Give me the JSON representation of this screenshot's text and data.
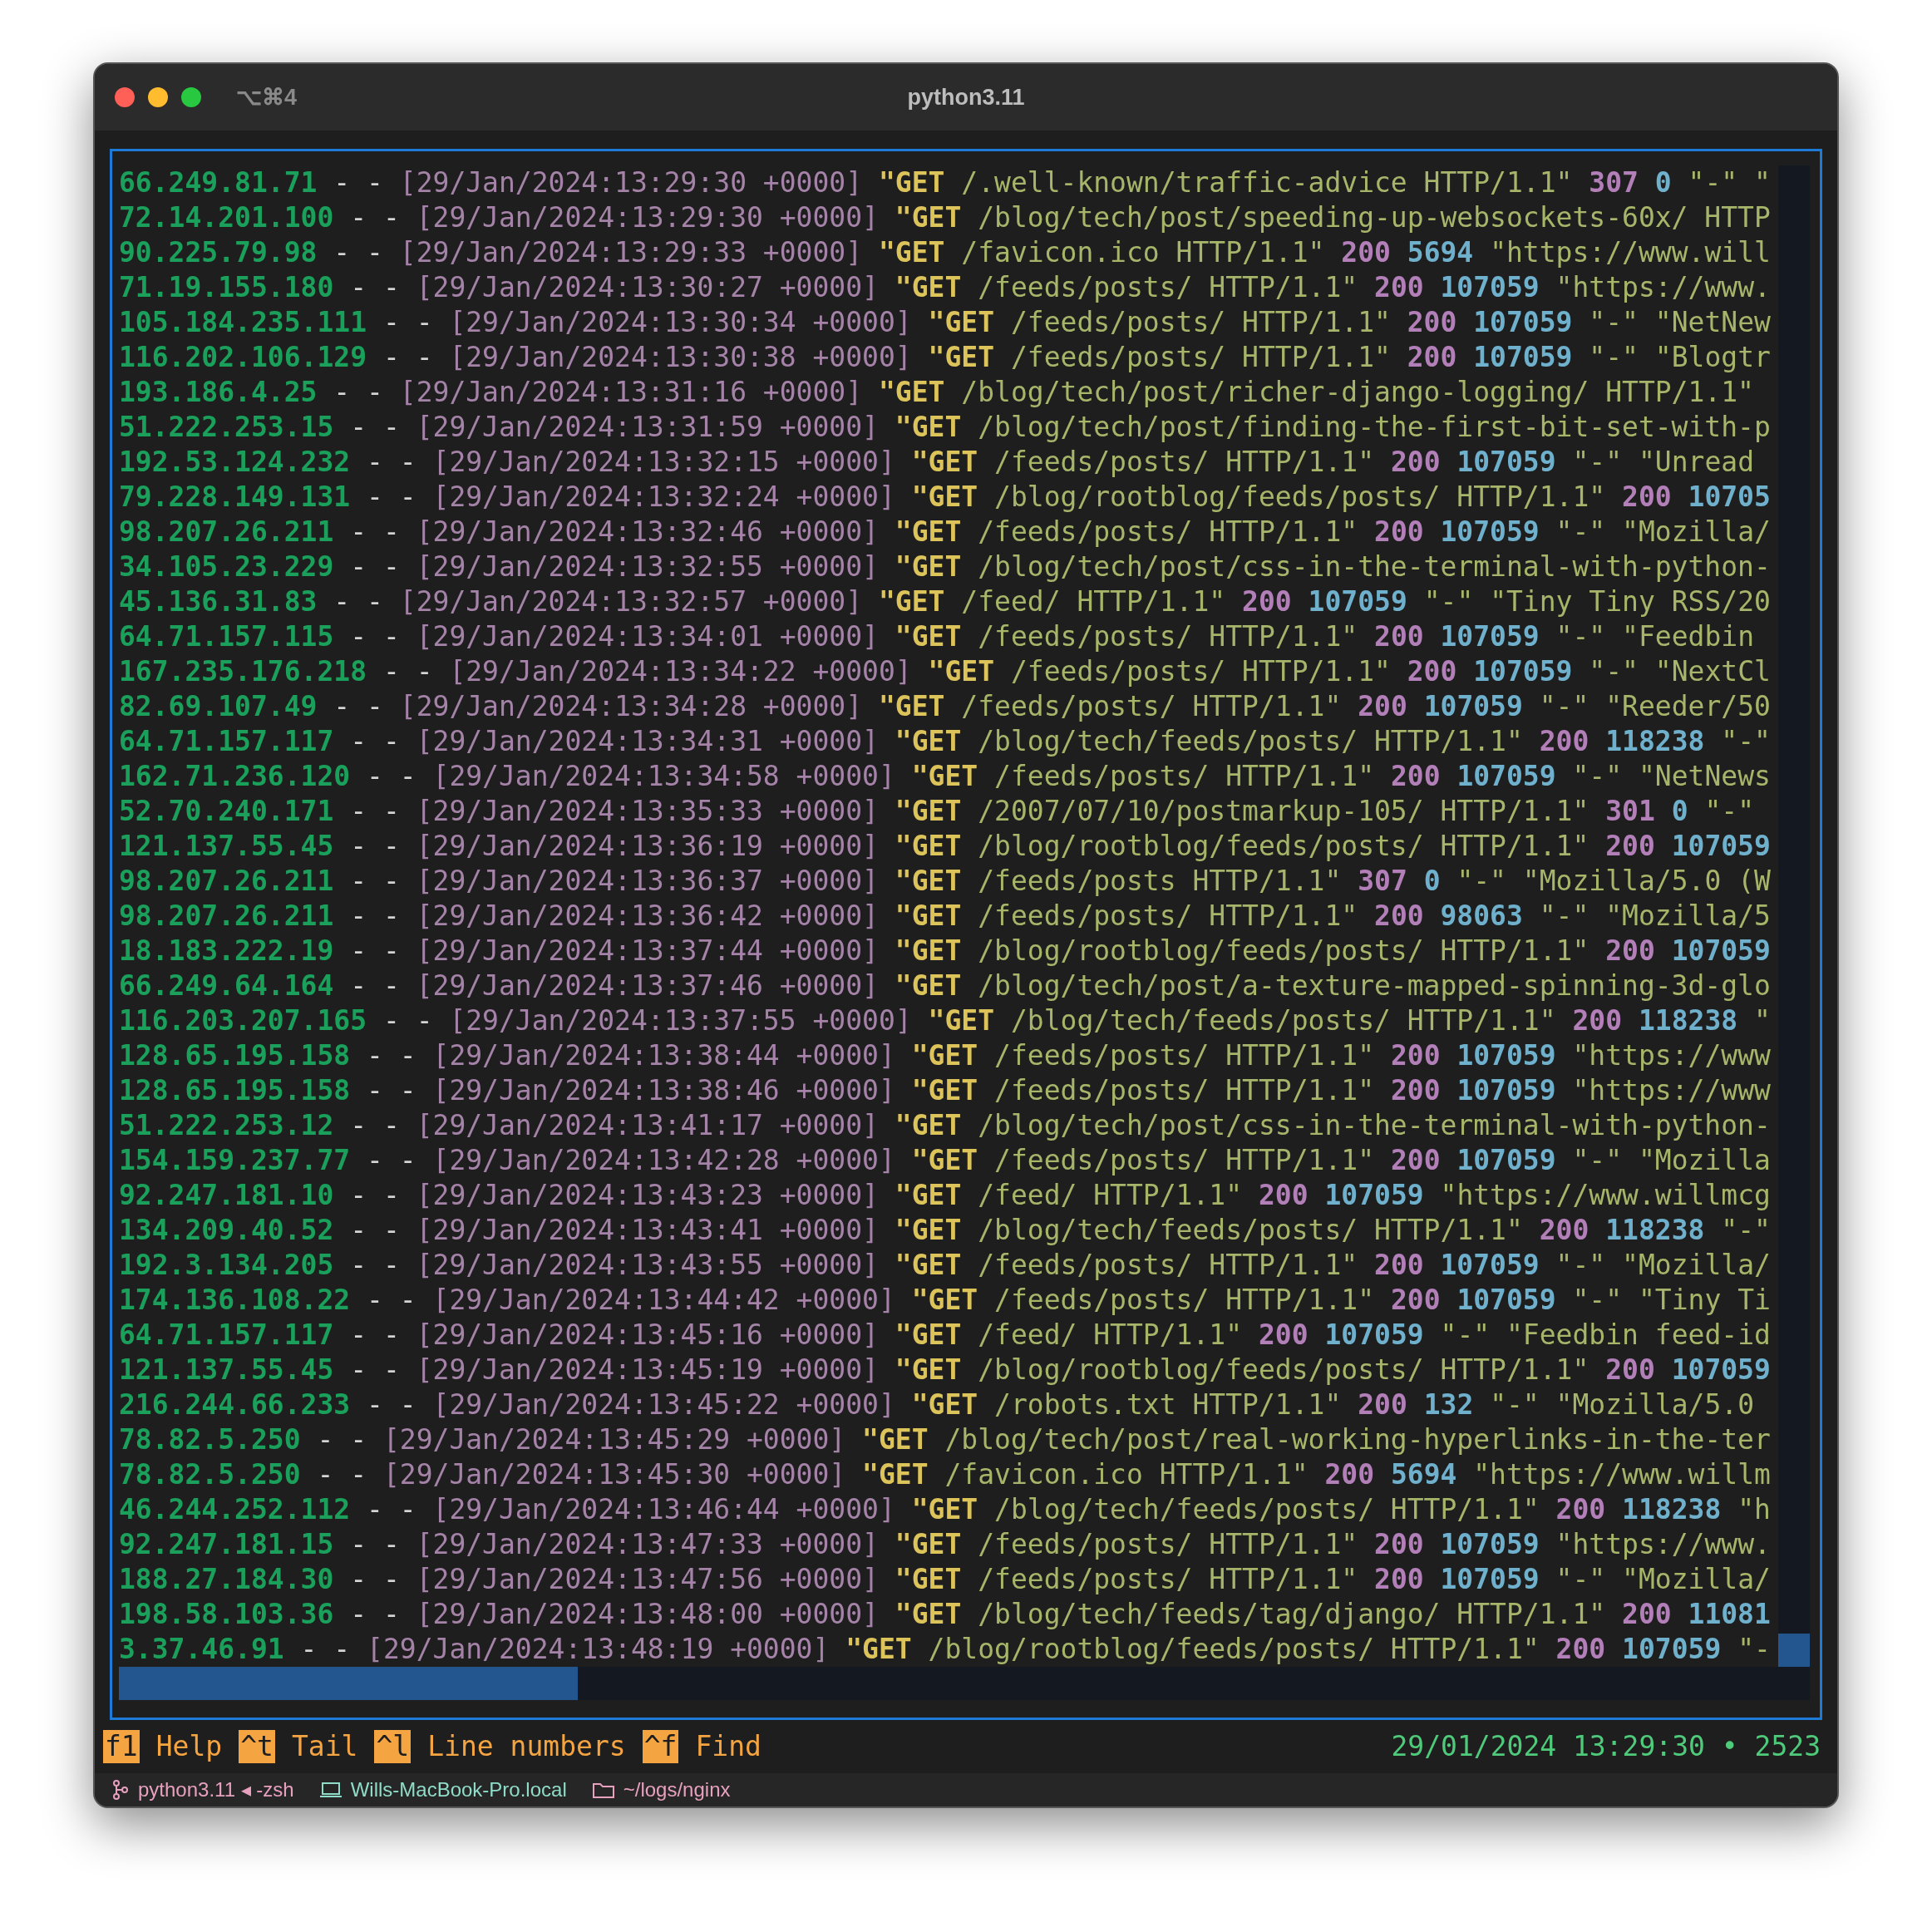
{
  "window": {
    "shortcut": "⌥⌘4",
    "title": "python3.11"
  },
  "log_lines": [
    {
      "ip": "66.249.81.71",
      "ident": "- -",
      "time": "[29/Jan/2024:13:29:30 +0000]",
      "method": "\"GET",
      "request": "/.well-known/traffic-advice HTTP/1.1\"",
      "status": "307",
      "size": "0",
      "tail": "\"-\" \""
    },
    {
      "ip": "72.14.201.100",
      "ident": "- -",
      "time": "[29/Jan/2024:13:29:30 +0000]",
      "method": "\"GET",
      "request": "/blog/tech/post/speeding-up-websockets-60x/ HTTP"
    },
    {
      "ip": "90.225.79.98",
      "ident": "- -",
      "time": "[29/Jan/2024:13:29:33 +0000]",
      "method": "\"GET",
      "request": "/favicon.ico HTTP/1.1\"",
      "status": "200",
      "size": "5694",
      "tail": "\"https://www.will"
    },
    {
      "ip": "71.19.155.180",
      "ident": "- -",
      "time": "[29/Jan/2024:13:30:27 +0000]",
      "method": "\"GET",
      "request": "/feeds/posts/ HTTP/1.1\"",
      "status": "200",
      "size": "107059",
      "tail": "\"https://www."
    },
    {
      "ip": "105.184.235.111",
      "ident": "- -",
      "time": "[29/Jan/2024:13:30:34 +0000]",
      "method": "\"GET",
      "request": "/feeds/posts/ HTTP/1.1\"",
      "status": "200",
      "size": "107059",
      "tail": "\"-\" \"NetNew"
    },
    {
      "ip": "116.202.106.129",
      "ident": "- -",
      "time": "[29/Jan/2024:13:30:38 +0000]",
      "method": "\"GET",
      "request": "/feeds/posts/ HTTP/1.1\"",
      "status": "200",
      "size": "107059",
      "tail": "\"-\" \"Blogtr"
    },
    {
      "ip": "193.186.4.25",
      "ident": "- -",
      "time": "[29/Jan/2024:13:31:16 +0000]",
      "method": "\"GET",
      "request": "/blog/tech/post/richer-django-logging/ HTTP/1.1\""
    },
    {
      "ip": "51.222.253.15",
      "ident": "- -",
      "time": "[29/Jan/2024:13:31:59 +0000]",
      "method": "\"GET",
      "request": "/blog/tech/post/finding-the-first-bit-set-with-p"
    },
    {
      "ip": "192.53.124.232",
      "ident": "- -",
      "time": "[29/Jan/2024:13:32:15 +0000]",
      "method": "\"GET",
      "request": "/feeds/posts/ HTTP/1.1\"",
      "status": "200",
      "size": "107059",
      "tail": "\"-\" \"Unread"
    },
    {
      "ip": "79.228.149.131",
      "ident": "- -",
      "time": "[29/Jan/2024:13:32:24 +0000]",
      "method": "\"GET",
      "request": "/blog/rootblog/feeds/posts/ HTTP/1.1\"",
      "status": "200",
      "size": "10705"
    },
    {
      "ip": "98.207.26.211",
      "ident": "- -",
      "time": "[29/Jan/2024:13:32:46 +0000]",
      "method": "\"GET",
      "request": "/feeds/posts/ HTTP/1.1\"",
      "status": "200",
      "size": "107059",
      "tail": "\"-\" \"Mozilla/"
    },
    {
      "ip": "34.105.23.229",
      "ident": "- -",
      "time": "[29/Jan/2024:13:32:55 +0000]",
      "method": "\"GET",
      "request": "/blog/tech/post/css-in-the-terminal-with-python-"
    },
    {
      "ip": "45.136.31.83",
      "ident": "- -",
      "time": "[29/Jan/2024:13:32:57 +0000]",
      "method": "\"GET",
      "request": "/feed/ HTTP/1.1\"",
      "status": "200",
      "size": "107059",
      "tail": "\"-\" \"Tiny Tiny RSS/20"
    },
    {
      "ip": "64.71.157.115",
      "ident": "- -",
      "time": "[29/Jan/2024:13:34:01 +0000]",
      "method": "\"GET",
      "request": "/feeds/posts/ HTTP/1.1\"",
      "status": "200",
      "size": "107059",
      "tail": "\"-\" \"Feedbin"
    },
    {
      "ip": "167.235.176.218",
      "ident": "- -",
      "time": "[29/Jan/2024:13:34:22 +0000]",
      "method": "\"GET",
      "request": "/feeds/posts/ HTTP/1.1\"",
      "status": "200",
      "size": "107059",
      "tail": "\"-\" \"NextCl"
    },
    {
      "ip": "82.69.107.49",
      "ident": "- -",
      "time": "[29/Jan/2024:13:34:28 +0000]",
      "method": "\"GET",
      "request": "/feeds/posts/ HTTP/1.1\"",
      "status": "200",
      "size": "107059",
      "tail": "\"-\" \"Reeder/50"
    },
    {
      "ip": "64.71.157.117",
      "ident": "- -",
      "time": "[29/Jan/2024:13:34:31 +0000]",
      "method": "\"GET",
      "request": "/blog/tech/feeds/posts/ HTTP/1.1\"",
      "status": "200",
      "size": "118238",
      "tail": "\"-\""
    },
    {
      "ip": "162.71.236.120",
      "ident": "- -",
      "time": "[29/Jan/2024:13:34:58 +0000]",
      "method": "\"GET",
      "request": "/feeds/posts/ HTTP/1.1\"",
      "status": "200",
      "size": "107059",
      "tail": "\"-\" \"NetNews"
    },
    {
      "ip": "52.70.240.171",
      "ident": "- -",
      "time": "[29/Jan/2024:13:35:33 +0000]",
      "method": "\"GET",
      "request": "/2007/07/10/postmarkup-105/ HTTP/1.1\"",
      "status": "301",
      "size": "0",
      "tail": "\"-\""
    },
    {
      "ip": "121.137.55.45",
      "ident": "- -",
      "time": "[29/Jan/2024:13:36:19 +0000]",
      "method": "\"GET",
      "request": "/blog/rootblog/feeds/posts/ HTTP/1.1\"",
      "status": "200",
      "size": "107059"
    },
    {
      "ip": "98.207.26.211",
      "ident": "- -",
      "time": "[29/Jan/2024:13:36:37 +0000]",
      "method": "\"GET",
      "request": "/feeds/posts HTTP/1.1\"",
      "status": "307",
      "size": "0",
      "tail": "\"-\" \"Mozilla/5.0 (W"
    },
    {
      "ip": "98.207.26.211",
      "ident": "- -",
      "time": "[29/Jan/2024:13:36:42 +0000]",
      "method": "\"GET",
      "request": "/feeds/posts/ HTTP/1.1\"",
      "status": "200",
      "size": "98063",
      "tail": "\"-\" \"Mozilla/5"
    },
    {
      "ip": "18.183.222.19",
      "ident": "- -",
      "time": "[29/Jan/2024:13:37:44 +0000]",
      "method": "\"GET",
      "request": "/blog/rootblog/feeds/posts/ HTTP/1.1\"",
      "status": "200",
      "size": "107059"
    },
    {
      "ip": "66.249.64.164",
      "ident": "- -",
      "time": "[29/Jan/2024:13:37:46 +0000]",
      "method": "\"GET",
      "request": "/blog/tech/post/a-texture-mapped-spinning-3d-glo"
    },
    {
      "ip": "116.203.207.165",
      "ident": "- -",
      "time": "[29/Jan/2024:13:37:55 +0000]",
      "method": "\"GET",
      "request": "/blog/tech/feeds/posts/ HTTP/1.1\"",
      "status": "200",
      "size": "118238",
      "tail": "\""
    },
    {
      "ip": "128.65.195.158",
      "ident": "- -",
      "time": "[29/Jan/2024:13:38:44 +0000]",
      "method": "\"GET",
      "request": "/feeds/posts/ HTTP/1.1\"",
      "status": "200",
      "size": "107059",
      "tail": "\"https://www"
    },
    {
      "ip": "128.65.195.158",
      "ident": "- -",
      "time": "[29/Jan/2024:13:38:46 +0000]",
      "method": "\"GET",
      "request": "/feeds/posts/ HTTP/1.1\"",
      "status": "200",
      "size": "107059",
      "tail": "\"https://www"
    },
    {
      "ip": "51.222.253.12",
      "ident": "- -",
      "time": "[29/Jan/2024:13:41:17 +0000]",
      "method": "\"GET",
      "request": "/blog/tech/post/css-in-the-terminal-with-python-"
    },
    {
      "ip": "154.159.237.77",
      "ident": "- -",
      "time": "[29/Jan/2024:13:42:28 +0000]",
      "method": "\"GET",
      "request": "/feeds/posts/ HTTP/1.1\"",
      "status": "200",
      "size": "107059",
      "tail": "\"-\" \"Mozilla"
    },
    {
      "ip": "92.247.181.10",
      "ident": "- -",
      "time": "[29/Jan/2024:13:43:23 +0000]",
      "method": "\"GET",
      "request": "/feed/ HTTP/1.1\"",
      "status": "200",
      "size": "107059",
      "tail": "\"https://www.willmcg"
    },
    {
      "ip": "134.209.40.52",
      "ident": "- -",
      "time": "[29/Jan/2024:13:43:41 +0000]",
      "method": "\"GET",
      "request": "/blog/tech/feeds/posts/ HTTP/1.1\"",
      "status": "200",
      "size": "118238",
      "tail": "\"-\""
    },
    {
      "ip": "192.3.134.205",
      "ident": "- -",
      "time": "[29/Jan/2024:13:43:55 +0000]",
      "method": "\"GET",
      "request": "/feeds/posts/ HTTP/1.1\"",
      "status": "200",
      "size": "107059",
      "tail": "\"-\" \"Mozilla/"
    },
    {
      "ip": "174.136.108.22",
      "ident": "- -",
      "time": "[29/Jan/2024:13:44:42 +0000]",
      "method": "\"GET",
      "request": "/feeds/posts/ HTTP/1.1\"",
      "status": "200",
      "size": "107059",
      "tail": "\"-\" \"Tiny Ti"
    },
    {
      "ip": "64.71.157.117",
      "ident": "- -",
      "time": "[29/Jan/2024:13:45:16 +0000]",
      "method": "\"GET",
      "request": "/feed/ HTTP/1.1\"",
      "status": "200",
      "size": "107059",
      "tail": "\"-\" \"Feedbin feed-id"
    },
    {
      "ip": "121.137.55.45",
      "ident": "- -",
      "time": "[29/Jan/2024:13:45:19 +0000]",
      "method": "\"GET",
      "request": "/blog/rootblog/feeds/posts/ HTTP/1.1\"",
      "status": "200",
      "size": "107059"
    },
    {
      "ip": "216.244.66.233",
      "ident": "- -",
      "time": "[29/Jan/2024:13:45:22 +0000]",
      "method": "\"GET",
      "request": "/robots.txt HTTP/1.1\"",
      "status": "200",
      "size": "132",
      "tail": "\"-\" \"Mozilla/5.0"
    },
    {
      "ip": "78.82.5.250",
      "ident": "- -",
      "time": "[29/Jan/2024:13:45:29 +0000]",
      "method": "\"GET",
      "request": "/blog/tech/post/real-working-hyperlinks-in-the-ter"
    },
    {
      "ip": "78.82.5.250",
      "ident": "- -",
      "time": "[29/Jan/2024:13:45:30 +0000]",
      "method": "\"GET",
      "request": "/favicon.ico HTTP/1.1\"",
      "status": "200",
      "size": "5694",
      "tail": "\"https://www.willm"
    },
    {
      "ip": "46.244.252.112",
      "ident": "- -",
      "time": "[29/Jan/2024:13:46:44 +0000]",
      "method": "\"GET",
      "request": "/blog/tech/feeds/posts/ HTTP/1.1\"",
      "status": "200",
      "size": "118238",
      "tail": "\"h"
    },
    {
      "ip": "92.247.181.15",
      "ident": "- -",
      "time": "[29/Jan/2024:13:47:33 +0000]",
      "method": "\"GET",
      "request": "/feeds/posts/ HTTP/1.1\"",
      "status": "200",
      "size": "107059",
      "tail": "\"https://www."
    },
    {
      "ip": "188.27.184.30",
      "ident": "- -",
      "time": "[29/Jan/2024:13:47:56 +0000]",
      "method": "\"GET",
      "request": "/feeds/posts/ HTTP/1.1\"",
      "status": "200",
      "size": "107059",
      "tail": "\"-\" \"Mozilla/"
    },
    {
      "ip": "198.58.103.36",
      "ident": "- -",
      "time": "[29/Jan/2024:13:48:00 +0000]",
      "method": "\"GET",
      "request": "/blog/tech/feeds/tag/django/ HTTP/1.1\"",
      "status": "200",
      "size": "11081"
    },
    {
      "ip": "3.37.46.91",
      "ident": "- -",
      "time": "[29/Jan/2024:13:48:19 +0000]",
      "method": "\"GET",
      "request": "/blog/rootblog/feeds/posts/ HTTP/1.1\"",
      "status": "200",
      "size": "107059",
      "tail": "\"-"
    }
  ],
  "footer": {
    "keys": [
      {
        "key": "f1",
        "label": "Help"
      },
      {
        "key": "^t",
        "label": "Tail"
      },
      {
        "key": "^l",
        "label": "Line numbers"
      },
      {
        "key": "^f",
        "label": "Find"
      }
    ],
    "info": "29/01/2024 13:29:30 • 2523"
  },
  "status_bar": {
    "process": "python3.11 ◂ -zsh",
    "host": "Wills-MacBook-Pro.local",
    "directory": "~/logs/nginx"
  }
}
